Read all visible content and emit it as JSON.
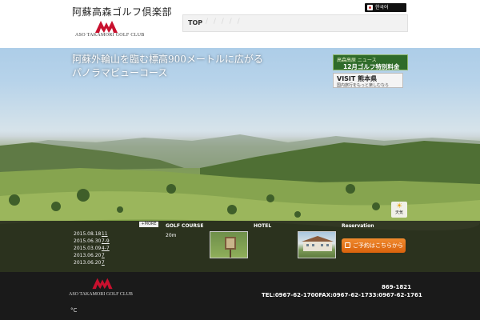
{
  "header": {
    "site_title": "阿蘇高森ゴルフ倶楽部",
    "logo_text": "ASO TAKAMORI GOLF CLUB",
    "lang_label": "한국어",
    "nav_top": "TOP",
    "nav_slashes": "/ / / / /"
  },
  "hero": {
    "tagline_line1": "阿蘇外輪山を臨む標高900メートルに広がる",
    "tagline_line2": "パノラマビューコース"
  },
  "banners": {
    "green_top": "高森高原 ニュース",
    "green_main": "12月ゴルフ特別料金",
    "visit_main": "VISIT 熊本県",
    "visit_sub": "国内旅行をもっと楽しむなら"
  },
  "weather": {
    "label": "天気"
  },
  "news": {
    "more_label": "+MORE",
    "items": [
      {
        "date": "2015.08.18",
        "title": "11"
      },
      {
        "date": "2015.06.30",
        "title": "7-9"
      },
      {
        "date": "2015.03.09",
        "title": "4-7"
      },
      {
        "date": "2013.06.20",
        "title": "7"
      },
      {
        "date": "2013.06.20",
        "title": "7"
      }
    ]
  },
  "sections": {
    "golf_course": "GOLF COURSE",
    "golf_course_sub": "20m",
    "hotel": "HOTEL",
    "reservation": "Reservation",
    "reserve_button": "ご予約はこちらから"
  },
  "footer": {
    "logo_text": "ASO TAKAMORI GOLF CLUB",
    "phone_short": "869-1821",
    "tel_line": "TEL:0967-62-1700FAX:0967-62-1733:0967-62-1761",
    "temp_unit": "°C"
  },
  "colors": {
    "logo_red": "#c8102e",
    "reserve_orange": "#e87722",
    "banner_green": "#2f6b2a"
  }
}
